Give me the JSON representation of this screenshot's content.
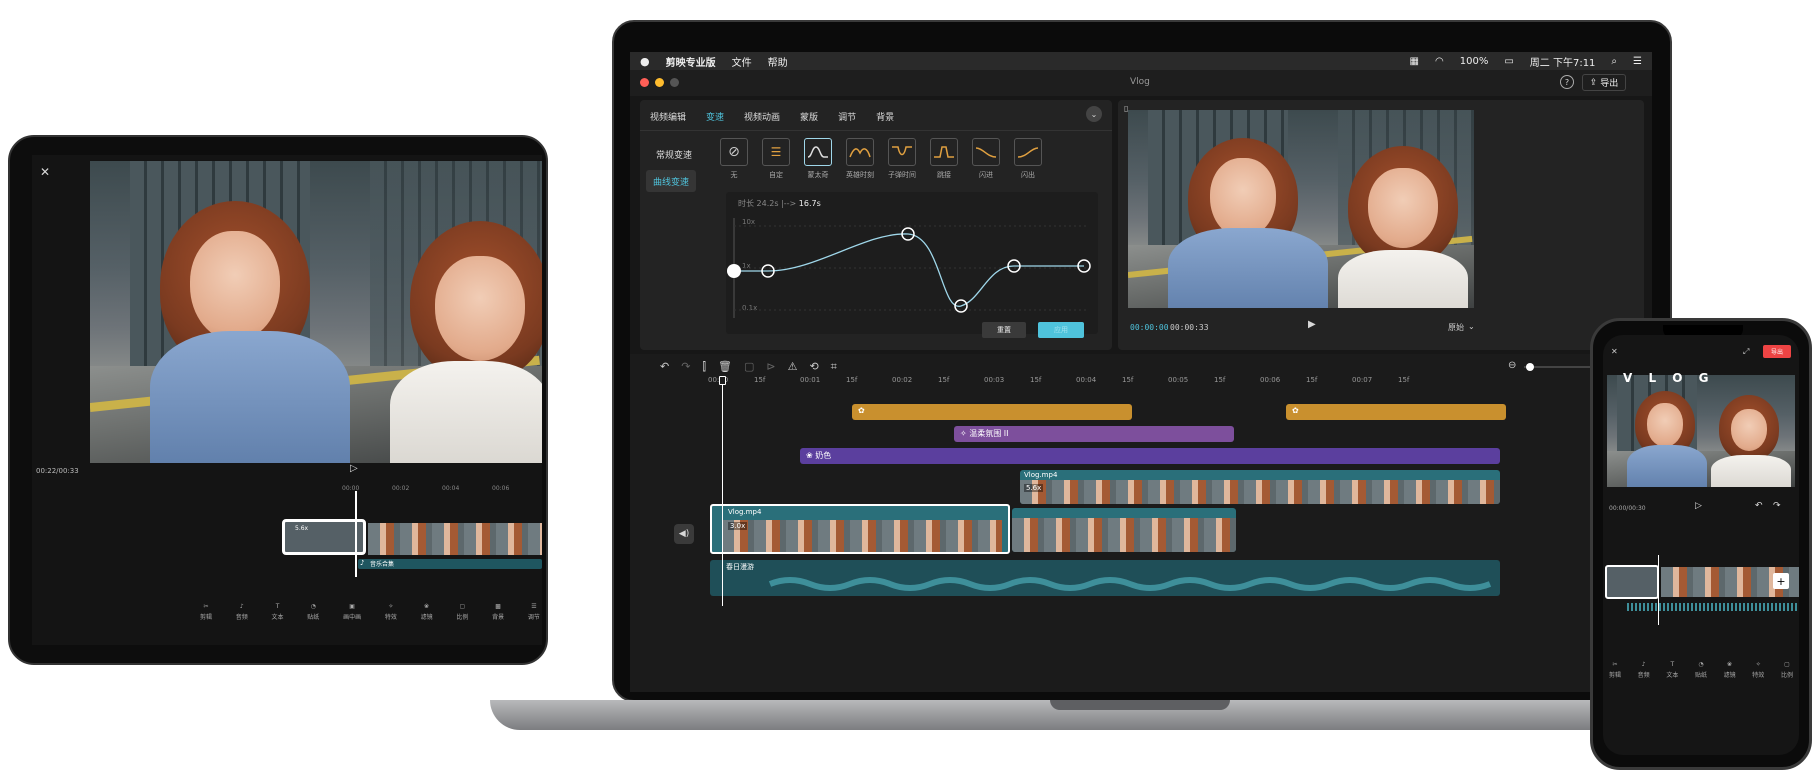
{
  "mac": {
    "menubar": {
      "apple_icon": "apple-icon",
      "app": "剪映专业版",
      "menu_file": "文件",
      "menu_help": "帮助",
      "battery": "100%",
      "clock": "周二 下午7:11"
    },
    "window": {
      "title": "Vlog",
      "export_label": "导出"
    },
    "tabs": [
      "视频编辑",
      "变速",
      "视频动画",
      "蒙版",
      "调节",
      "背景"
    ],
    "active_tab": "变速",
    "side_tabs": [
      "常规变速",
      "曲线变速"
    ],
    "speed_presets": [
      "无",
      "自定",
      "蒙太奇",
      "英雄时刻",
      "子弹时间",
      "跳接",
      "闪进",
      "闪出"
    ],
    "duration_label": "时长 24.2s",
    "duration_arrow": "|-->",
    "duration_new": "16.7s",
    "curve_max": "10x",
    "curve_min": "0.1x",
    "curve_mid": "1x",
    "curve_points": [
      1.0,
      1.0,
      1.8,
      0.3,
      1.0,
      1.0
    ],
    "reset_label": "重置",
    "apply_label": "应用",
    "preview": {
      "current": "00:00:00",
      "total": "00:00:33",
      "ratio": "原始"
    },
    "ruler": [
      "00:00",
      "15f",
      "00:01",
      "15f",
      "00:02",
      "15f",
      "00:03",
      "15f",
      "00:04",
      "15f",
      "00:05",
      "15f",
      "00:06",
      "15f",
      "00:07",
      "15f"
    ],
    "tracks": {
      "purple_clip": "温柔氛围 II",
      "violet_clip": "奶色",
      "video_clip_2": "Vlog.mp4",
      "video_clip_2_speed": "5.6x",
      "video_clip_1": "Vlog.mp4",
      "video_clip_1_speed": "3.0x",
      "audio_clip": "春日漫游"
    },
    "colors": {
      "accent": "#4fc3dc",
      "gold": "#c9902e",
      "purple": "#7d4f9c",
      "violet": "#5b3f9e",
      "teal": "#2a6f7a"
    }
  },
  "tablet": {
    "time": "00:22/00:33",
    "ruler": [
      "00:00",
      "00:02",
      "00:04",
      "00:06"
    ],
    "clip_speed": "5.6x",
    "audio_label": "音乐合集",
    "toolbar": [
      "剪辑",
      "音频",
      "文本",
      "贴纸",
      "画中画",
      "特效",
      "滤镜",
      "比例",
      "背景",
      "调节"
    ]
  },
  "phone": {
    "overlay_text": "V L O G",
    "export_label": "导出",
    "time": "00:00/00:30",
    "toolbar": [
      "剪辑",
      "音频",
      "文本",
      "贴纸",
      "滤镜",
      "特效",
      "比例"
    ]
  }
}
